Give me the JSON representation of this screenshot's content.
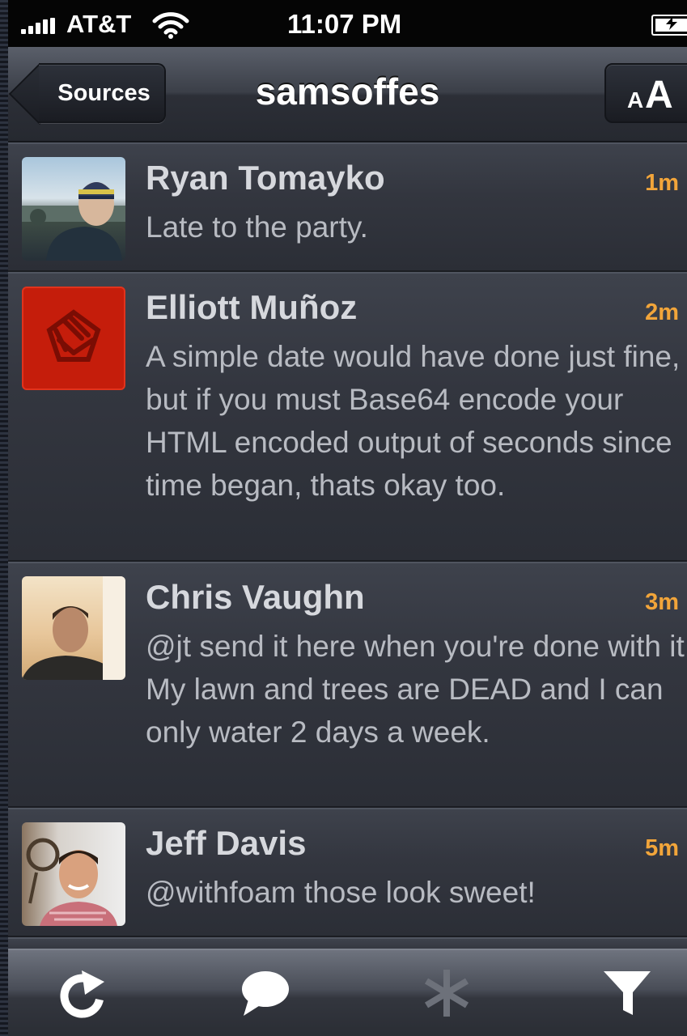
{
  "status_bar": {
    "carrier": "AT&T",
    "time": "11:07 PM"
  },
  "nav": {
    "back_label": "Sources",
    "title": "samsoffes",
    "font_small": "A",
    "font_large": "A"
  },
  "tweets": [
    {
      "name": "Ryan Tomayko",
      "time": "1m",
      "text": "Late to the party."
    },
    {
      "name": "Elliott Muñoz",
      "time": "2m",
      "text": "A simple date would have done just fine, but if you must Base64 encode your HTML encoded output of seconds since time began, thats okay too."
    },
    {
      "name": "Chris Vaughn",
      "time": "3m",
      "text": "@jt send it here when you're done with it.  My lawn and trees are DEAD and I can only water 2 days a week."
    },
    {
      "name": "Jeff Davis",
      "time": "5m",
      "text": "@withfoam those look sweet!"
    }
  ],
  "toolbar": {
    "icons": [
      "refresh-icon",
      "speech-bubble-icon",
      "asterisk-icon",
      "filter-icon"
    ]
  },
  "colors": {
    "accent_time": "#f2a53a",
    "avatar_red": "#c51d0b"
  }
}
